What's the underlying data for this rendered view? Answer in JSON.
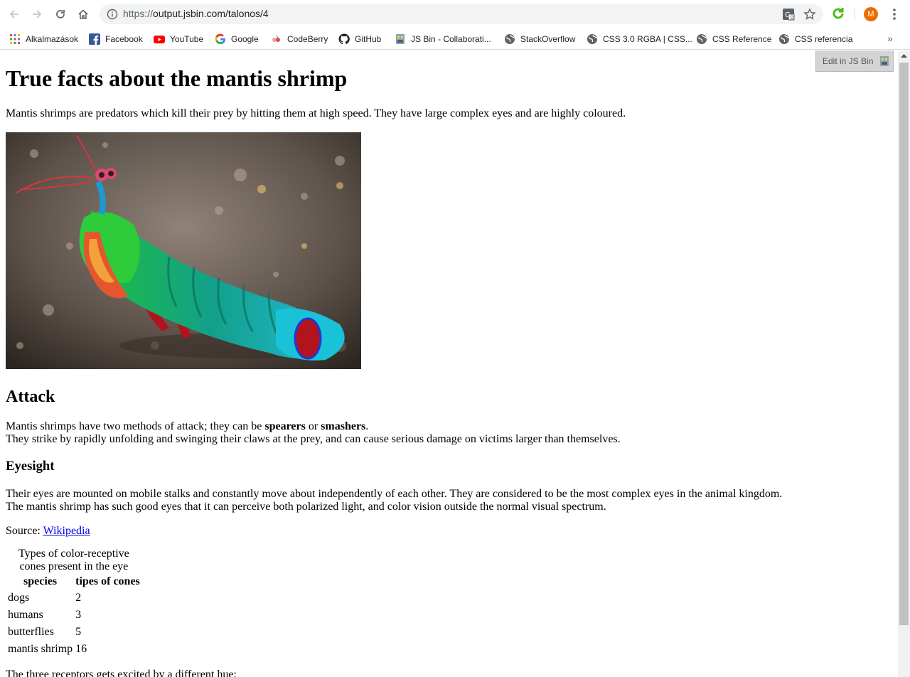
{
  "browser": {
    "url_scheme": "https://",
    "url_rest": "output.jsbin.com/talonos/4",
    "avatar_letter": "M"
  },
  "bookmarks": [
    {
      "label": "Alkalmazások",
      "icon": "apps-grid-icon"
    },
    {
      "label": "Facebook",
      "icon": "facebook-icon"
    },
    {
      "label": "YouTube",
      "icon": "youtube-icon"
    },
    {
      "label": "Google",
      "icon": "google-icon"
    },
    {
      "label": "CodeBerry",
      "icon": "codeberry-icon"
    },
    {
      "label": "GitHub",
      "icon": "github-icon"
    },
    {
      "label": "JS Bin - Collaborati...",
      "icon": "jsbin-icon"
    },
    {
      "label": "StackOverflow",
      "icon": "globe-icon"
    },
    {
      "label": "CSS 3.0 RGBA | CSS...",
      "icon": "globe-icon"
    },
    {
      "label": "CSS Reference",
      "icon": "globe-icon"
    },
    {
      "label": "CSS referencia",
      "icon": "globe-icon"
    }
  ],
  "page": {
    "title": "True facts about the mantis shrimp",
    "intro": "Mantis shrimps are predators which kill their prey by hitting them at high speed. They have large complex eyes and are highly coloured.",
    "attack_heading": "Attack",
    "attack_text_pre": "Mantis shrimps have two methods of attack; they can be ",
    "attack_bold1": "spearers",
    "attack_or": " or ",
    "attack_bold2": "smashers",
    "attack_end": ".",
    "attack_line2": "They strike by rapidly unfolding and swinging their claws at the prey, and can cause serious damage on victims larger than themselves.",
    "eyesight_heading": "Eyesight",
    "eyesight_line1": "Their eyes are mounted on mobile stalks and constantly move about independently of each other. They are considered to be the most complex eyes in the animal kingdom.",
    "eyesight_line2": "The mantis shrimp has such good eyes that it can perceive both polarized light, and color vision outside the normal visual spectrum.",
    "source_label": "Source: ",
    "source_link": "Wikipedia",
    "table_caption": "Types of color-receptive cones present in the eye",
    "table_headers": [
      "species",
      "tipes of cones"
    ],
    "table_rows": [
      [
        "dogs",
        "2"
      ],
      [
        "humans",
        "3"
      ],
      [
        "butterflies",
        "5"
      ],
      [
        "mantis shrimp",
        "16"
      ]
    ],
    "receptors_text": "The three receptors gets excited by a different hue:"
  },
  "edit_jsbin_label": "Edit in JS Bin"
}
